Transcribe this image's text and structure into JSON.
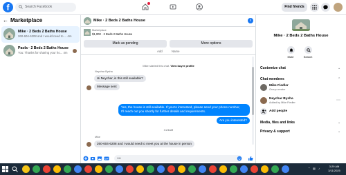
{
  "topbar": {
    "search_placeholder": "Search Facebook",
    "find_friends": "Find friends",
    "notif_badge": ""
  },
  "sidebar": {
    "heading": "Marketplace",
    "conversations": [
      {
        "title": "Mike · 2 Beds 2 Baths House",
        "preview": "260-604-6208 and I would need to ... 4m"
      },
      {
        "title": "Paola · 2 Beds 2 Baths House",
        "preview": "You: Thanks for sharing your ho... 4m"
      }
    ]
  },
  "chat": {
    "title": "Mike · 2 Beds 2 Baths House",
    "marketplace_label": "Marketplace",
    "price_line": "$1,000 · 2 Beds 2 Baths House",
    "mark_pending": "Mark as pending",
    "more_options": "More options",
    "add_label": "Add",
    "name_label": "Name",
    "system_msg_prefix": "Mike started this chat.",
    "view_buyer_profile": "View buyer profile",
    "sender_name": "Neychar Bysha",
    "msg_in_1": "Hi Neychar, is this still available?",
    "msg_in_2": "Message sent",
    "msg_out_1a": "Yes, the house is still available. If you're interested, please send your phone number,",
    "msg_out_1b": "I'll reach out you shortly for further details and requirements.",
    "msg_out_2": "Are you interested?",
    "timestamp": "3:24AM",
    "sender_mike": "Mike",
    "msg_in_3": "260-604-6208 and I would need to meet you at the house in person",
    "composer_placeholder": "Aa"
  },
  "right": {
    "title": "Mike · 2 Beds 2 Baths House",
    "mute": "Mute",
    "search": "Search",
    "customize_chat": "Customize chat",
    "chat_members": "Chat members",
    "members": [
      {
        "name": "Mike Fiedler",
        "role": "Group creator"
      },
      {
        "name": "Neychar Bysha",
        "role": "Added by Mike Fiedler"
      }
    ],
    "add_people": "Add people",
    "media": "Media, files and links",
    "privacy": "Privacy & support"
  },
  "taskbar": {
    "time": "3:29 AM",
    "date": "3/11/2025"
  },
  "colors": {
    "accent": "#1877f2",
    "bubble_out": "#0084ff",
    "taskbar": "#1c2b3a"
  }
}
